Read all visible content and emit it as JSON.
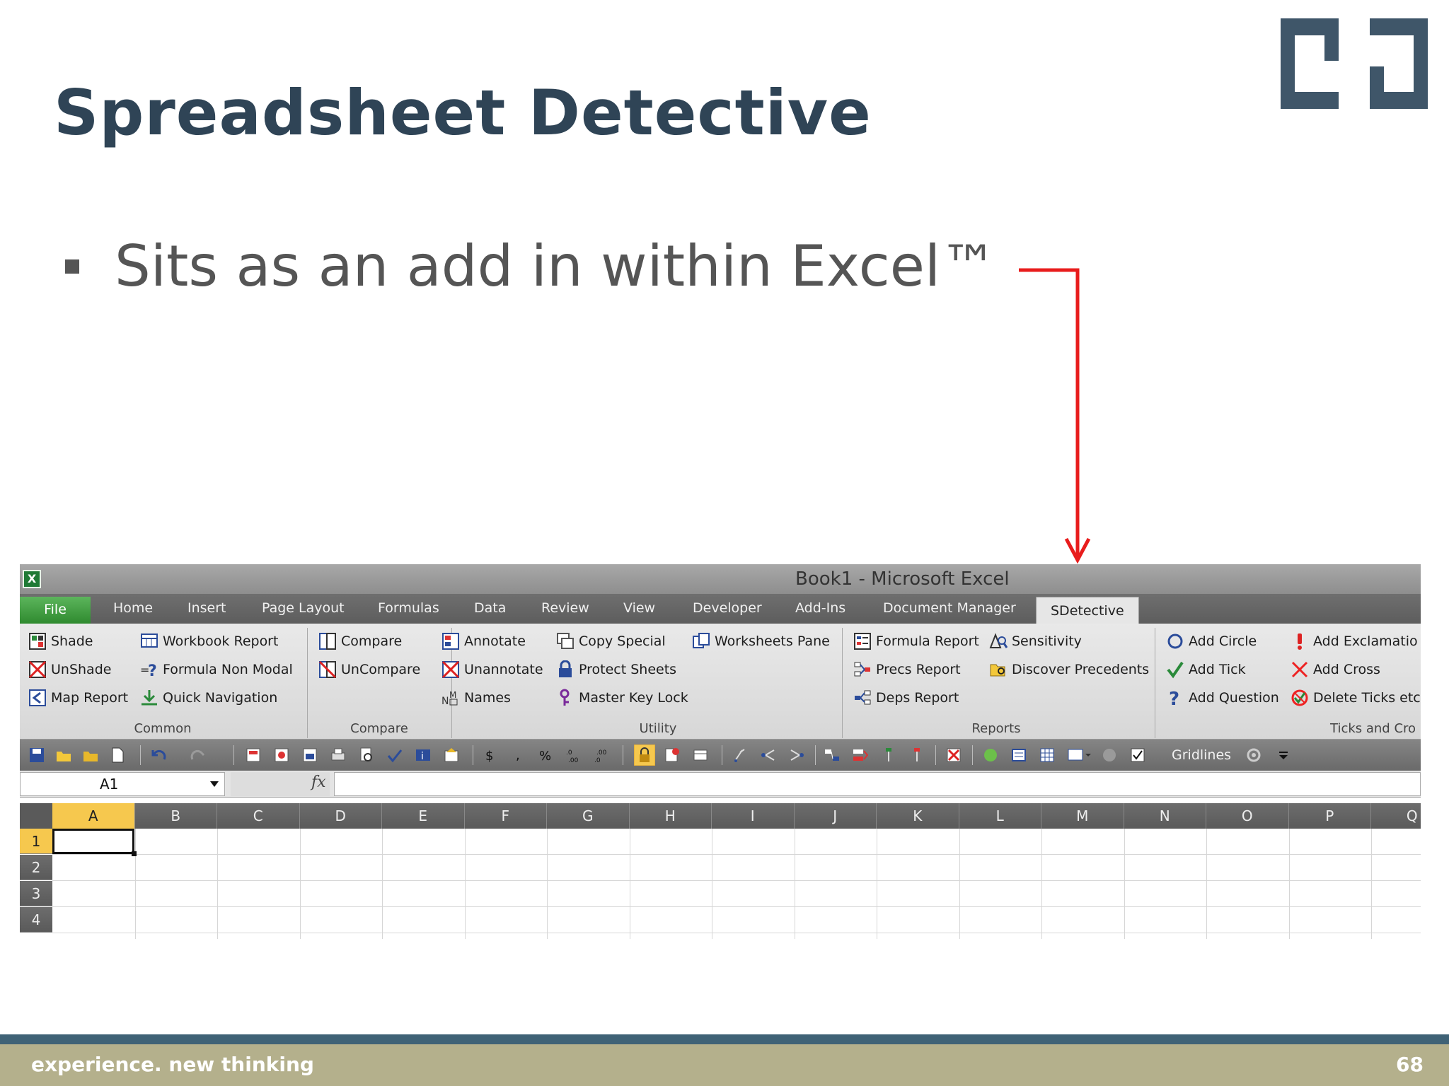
{
  "slide": {
    "title": "Spreadsheet Detective",
    "bullet": "Sits as an add in within Excel™",
    "footer_tagline": "experience. new thinking",
    "page_number": "68",
    "colors": {
      "title": "#2f4456",
      "arrow": "#e81c1c",
      "footer_band": "#b4b08c",
      "footer_line": "#3f6276",
      "logo": "#3f5669"
    }
  },
  "excel": {
    "window_title": "Book1  -  Microsoft Excel",
    "tabs": [
      "File",
      "Home",
      "Insert",
      "Page Layout",
      "Formulas",
      "Data",
      "Review",
      "View",
      "Developer",
      "Add-Ins",
      "Document Manager",
      "SDetective"
    ],
    "active_tab": "SDetective",
    "groups": {
      "common": {
        "label": "Common",
        "items": [
          "Shade",
          "UnShade",
          "Map Report",
          "Workbook Report",
          "Formula Non Modal",
          "Quick Navigation"
        ]
      },
      "compare": {
        "label": "Compare",
        "items": [
          "Compare",
          "UnCompare"
        ]
      },
      "utility": {
        "label": "Utility",
        "items": [
          "Annotate",
          "Unannotate",
          "Names",
          "Copy Special",
          "Protect Sheets",
          "Master Key Lock",
          "Worksheets Pane"
        ]
      },
      "reports": {
        "label": "Reports",
        "items": [
          "Formula Report",
          "Precs Report",
          "Deps Report",
          "Sensitivity",
          "Discover Precedents"
        ]
      },
      "ticks": {
        "label": "Ticks and Cro",
        "items": [
          "Add Circle",
          "Add Tick",
          "Add Question",
          "Add Exclamatio",
          "Add Cross",
          "Delete Ticks etc."
        ]
      }
    },
    "qat": {
      "gridlines_label": "Gridlines",
      "gridlines_checked": true
    },
    "name_box": "A1",
    "fx_symbol": "fx",
    "columns": [
      "A",
      "B",
      "C",
      "D",
      "E",
      "F",
      "G",
      "H",
      "I",
      "J",
      "K",
      "L",
      "M",
      "N",
      "O",
      "P",
      "Q"
    ],
    "rows": [
      "1",
      "2",
      "3",
      "4"
    ],
    "selected_cell": "A1"
  }
}
